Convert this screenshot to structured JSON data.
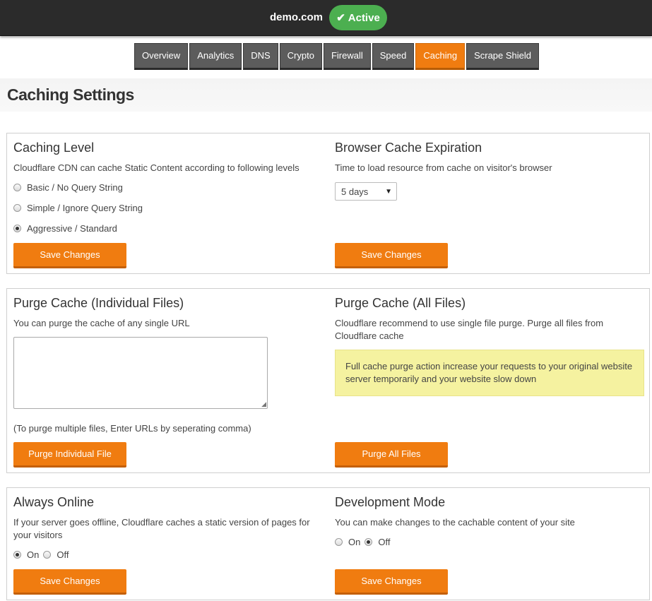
{
  "header": {
    "domain": "demo.com",
    "status": "Active"
  },
  "tabs": [
    {
      "label": "Overview",
      "active": false
    },
    {
      "label": "Analytics",
      "active": false
    },
    {
      "label": "DNS",
      "active": false
    },
    {
      "label": "Crypto",
      "active": false
    },
    {
      "label": "Firewall",
      "active": false
    },
    {
      "label": "Speed",
      "active": false
    },
    {
      "label": "Caching",
      "active": true
    },
    {
      "label": "Scrape Shield",
      "active": false
    }
  ],
  "page_title": "Caching Settings",
  "caching_level": {
    "title": "Caching Level",
    "description": "Cloudflare CDN can cache Static Content according to following levels",
    "options": [
      {
        "label": "Basic / No Query String",
        "checked": false
      },
      {
        "label": "Simple / Ignore Query String",
        "checked": false
      },
      {
        "label": "Aggressive / Standard",
        "checked": true
      }
    ],
    "button": "Save Changes"
  },
  "browser_cache": {
    "title": "Browser Cache Expiration",
    "description": "Time to load resource from cache on visitor's browser",
    "selected": "5 days",
    "button": "Save Changes"
  },
  "purge_individual": {
    "title": "Purge Cache (Individual Files)",
    "description": "You can purge the cache of any single URL",
    "textarea_value": "",
    "note": "(To purge multiple files, Enter URLs by seperating comma)",
    "button": "Purge Individual File"
  },
  "purge_all": {
    "title": "Purge Cache (All Files)",
    "description": "Cloudflare recommend to use single file purge. Purge all files from Cloudflare cache",
    "warning": "Full cache purge action increase your requests to your original website server temporarily and your website slow down",
    "button": "Purge All Files"
  },
  "always_online": {
    "title": "Always Online",
    "description": "If your server goes offline, Cloudflare caches a static version of pages for your visitors",
    "on_label": "On",
    "off_label": "Off",
    "value": "On",
    "button": "Save Changes"
  },
  "dev_mode": {
    "title": "Development Mode",
    "description": "You can make changes to the cachable content of your site",
    "on_label": "On",
    "off_label": "Off",
    "value": "Off",
    "button": "Save Changes"
  },
  "colors": {
    "accent": "#f07c10",
    "success": "#4caf50",
    "topbar": "#2b2b2b",
    "tab": "#5c5c5c",
    "warning_bg": "#f5f2a0"
  }
}
